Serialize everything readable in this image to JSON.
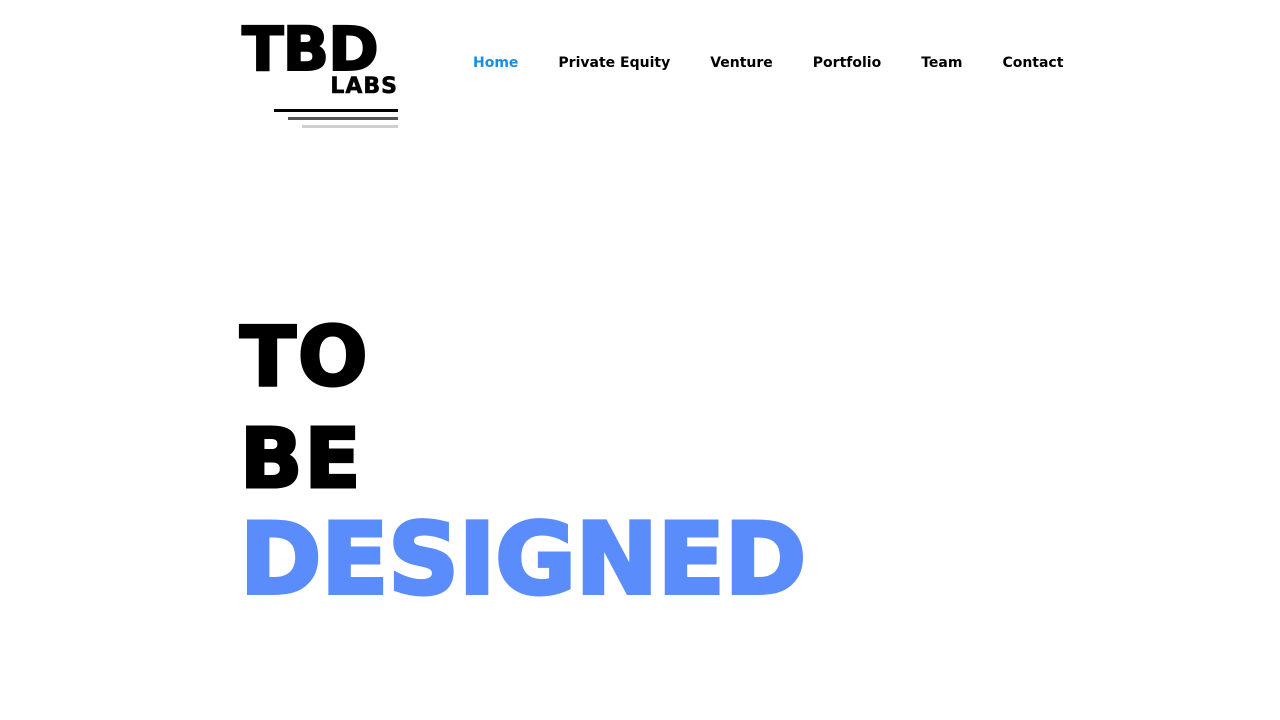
{
  "logo": {
    "primary": "TBD",
    "secondary": "LABS"
  },
  "nav": {
    "items": [
      {
        "label": "Home",
        "active": true
      },
      {
        "label": "Private Equity",
        "active": false
      },
      {
        "label": "Venture",
        "active": false
      },
      {
        "label": "Portfolio",
        "active": false
      },
      {
        "label": "Team",
        "active": false
      },
      {
        "label": "Contact",
        "active": false
      }
    ]
  },
  "hero": {
    "line1": "TO",
    "line2": "BE",
    "line3": "DESIGNED"
  },
  "colors": {
    "accent_nav": "#1a8ee0",
    "hero_highlight": "#5b8cfb",
    "text": "#000000",
    "background": "#ffffff"
  }
}
